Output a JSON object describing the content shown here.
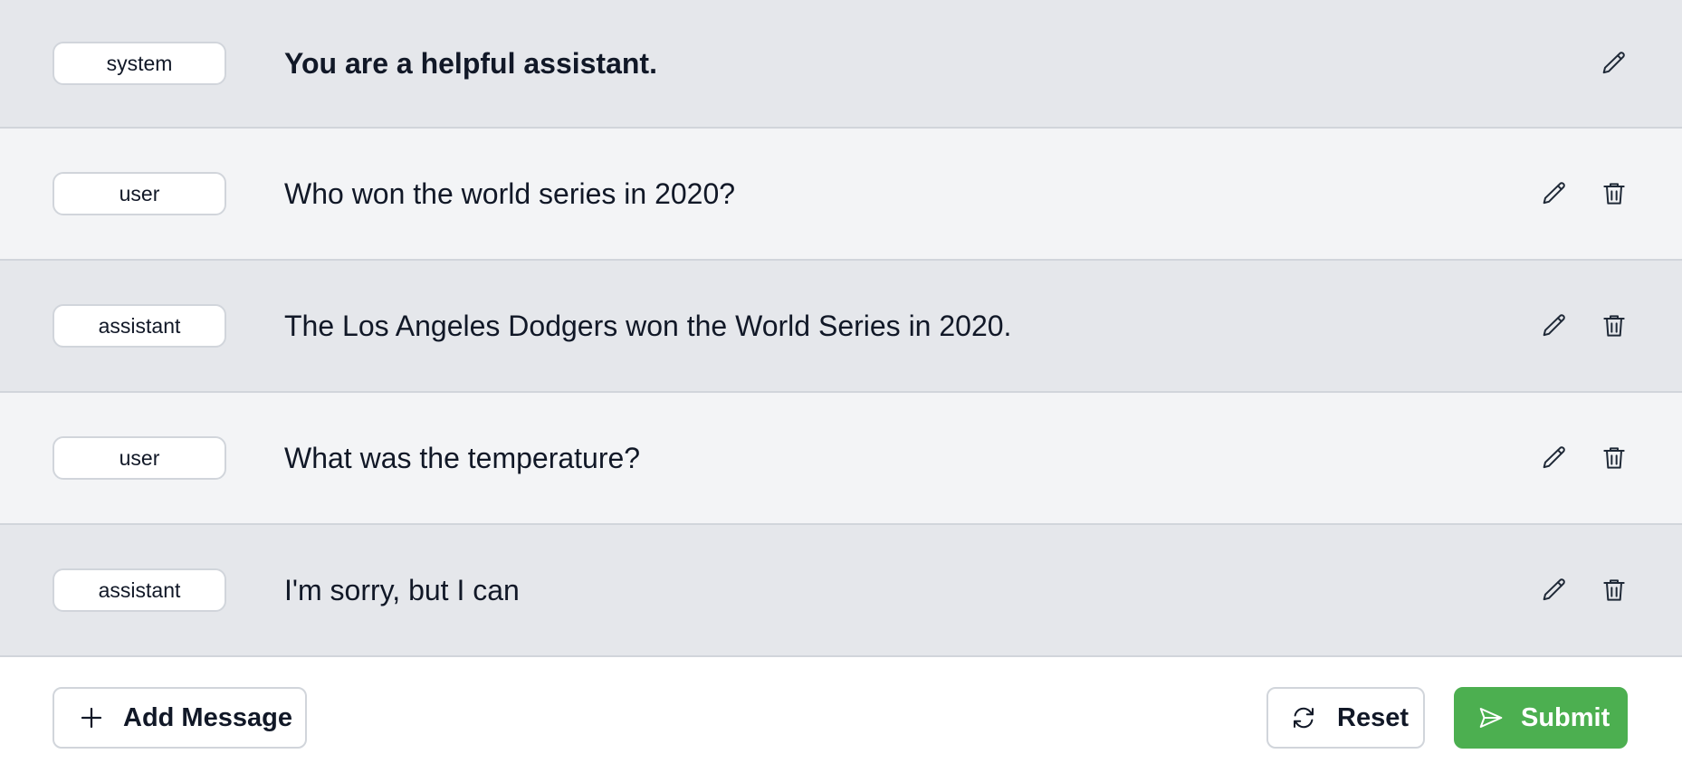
{
  "messages": [
    {
      "role": "system",
      "content": "You are a helpful assistant.",
      "deletable": false
    },
    {
      "role": "user",
      "content": "Who won the world series in 2020?",
      "deletable": true
    },
    {
      "role": "assistant",
      "content": "The Los Angeles Dodgers won the World Series in 2020.",
      "deletable": true
    },
    {
      "role": "user",
      "content": "What was the temperature?",
      "deletable": true
    },
    {
      "role": "assistant",
      "content": "I'm sorry, but I can",
      "deletable": true
    }
  ],
  "icons": {
    "edit": "pencil-icon",
    "delete": "trash-icon",
    "add": "plus-icon",
    "reset": "refresh-icon",
    "submit": "send-icon"
  },
  "footer": {
    "add_label": "Add Message",
    "reset_label": "Reset",
    "submit_label": "Submit"
  },
  "colors": {
    "row_dark": "#e5e7eb",
    "row_light": "#f3f4f6",
    "submit_green": "#4caf50"
  }
}
